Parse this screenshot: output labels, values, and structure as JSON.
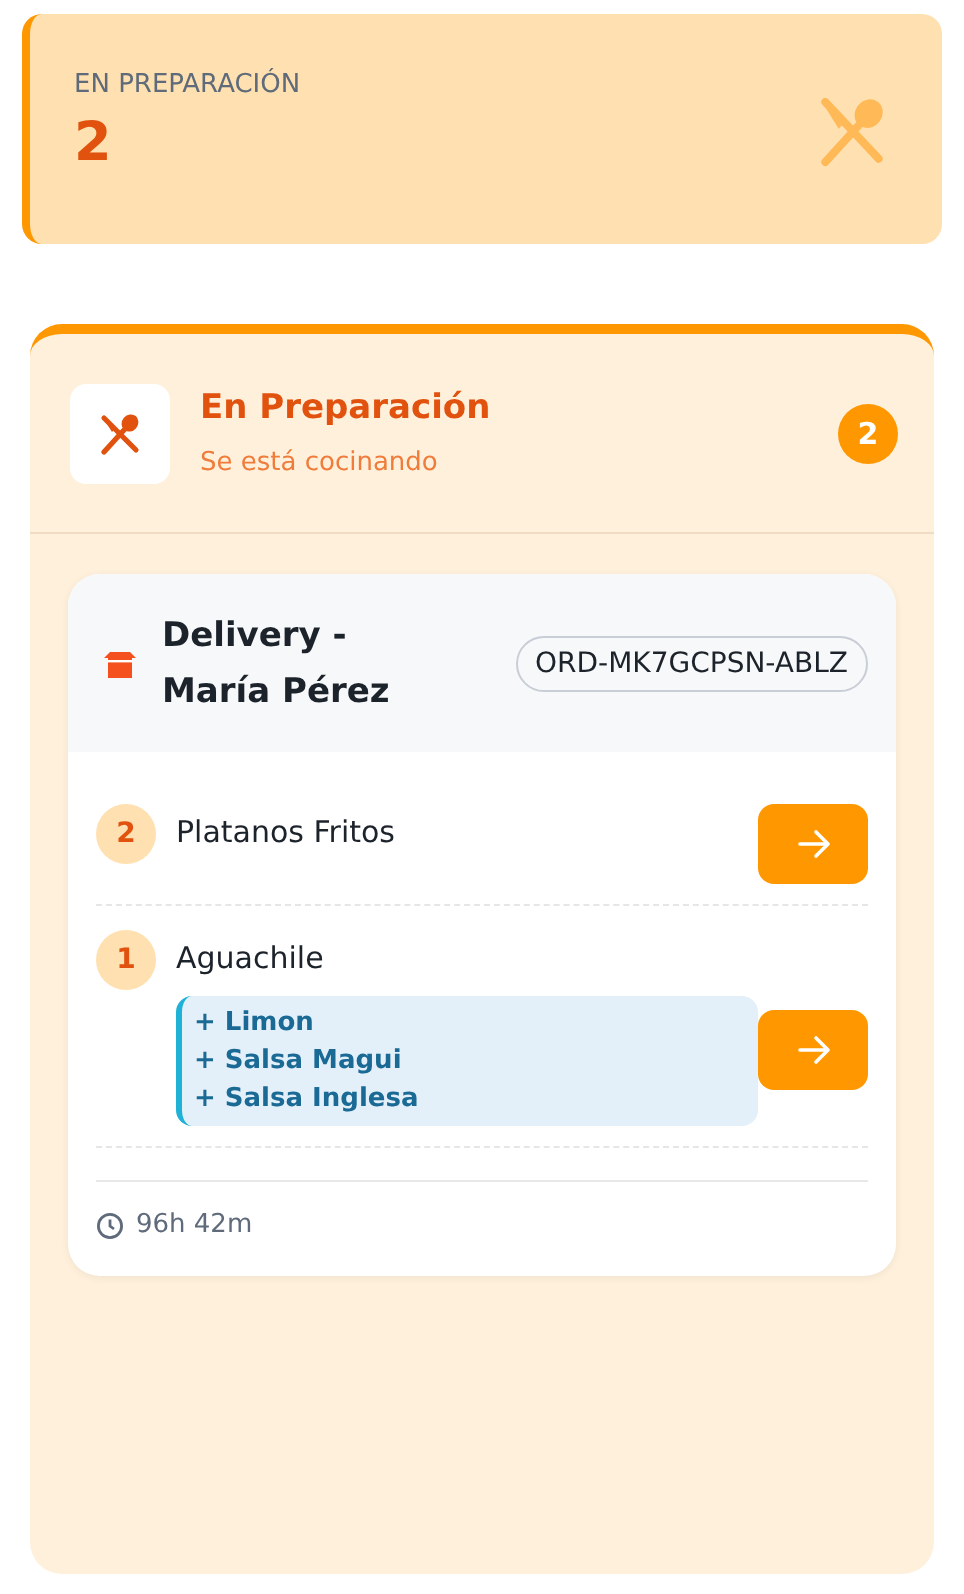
{
  "stat": {
    "label": "EN PREPARACIÓN",
    "value": "2"
  },
  "column": {
    "title": "En Preparación",
    "subtitle": "Se está cocinando",
    "count": "2"
  },
  "orders": [
    {
      "title": "Delivery - María Pérez",
      "code": "ORD-MK7GCPSN-ABLZ",
      "elapsed": "96h 42m",
      "items": [
        {
          "qty": "2",
          "name": "Platanos Fritos"
        },
        {
          "qty": "1",
          "name": "Aguachile",
          "modifiers": [
            "+ Limon",
            "+ Salsa Magui",
            "+ Salsa Inglesa"
          ]
        }
      ]
    }
  ]
}
